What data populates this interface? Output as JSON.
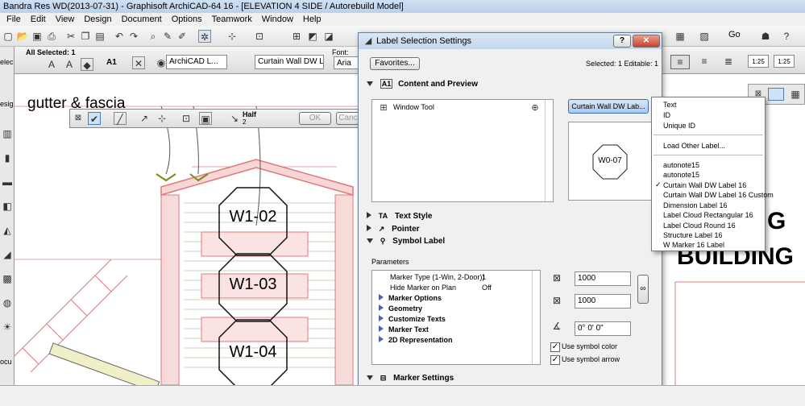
{
  "title": "Bandra Res WD(2013-07-31) - Graphisoft ArchiCAD-64 16 - [ELEVATION 4 SIDE / Autorebuild Model]",
  "menu": [
    "File",
    "Edit",
    "View",
    "Design",
    "Document",
    "Options",
    "Teamwork",
    "Window",
    "Help"
  ],
  "infobar": {
    "all_selected": "All Selected: 1",
    "layer": "ArchiCAD L...",
    "label_name": "Curtain Wall DW L...",
    "font_label": "Font:",
    "font_value": "Aria",
    "go_label": "Go",
    "scale_a": "1:25",
    "scale_b": "1:25",
    "tool_text": "A1"
  },
  "left_labels": [
    "elec",
    "esig",
    "ocu"
  ],
  "palette": {
    "half_label": "Half",
    "half_value": "2",
    "ok": "OK",
    "cancel": "Canc"
  },
  "drawing": {
    "gutter_text": "gutter & fascia",
    "markers": [
      "W1-02",
      "W1-03",
      "W1-04"
    ],
    "right_text_1": "G",
    "right_text_2": "BUILDING"
  },
  "dialog": {
    "title": "Label Selection Settings",
    "favorites": "Favorites...",
    "selected_info": "Selected: 1 Editable: 1",
    "content_preview": "Content and Preview",
    "tool_name": "Window Tool",
    "label_button": "Curtain Wall DW Lab...",
    "preview_marker": "W0-07",
    "text_style": "Text Style",
    "pointer": "Pointer",
    "symbol_label": "Symbol Label",
    "parameters": "Parameters",
    "params": [
      {
        "name": "Marker Type (1-Win, 2-Door))",
        "value": "1",
        "bold": false
      },
      {
        "name": "Hide Marker on Plan",
        "value": "Off",
        "bold": false
      },
      {
        "name": "Marker Options",
        "value": "",
        "bold": true
      },
      {
        "name": "Geometry",
        "value": "",
        "bold": true
      },
      {
        "name": "Customize Texts",
        "value": "",
        "bold": true
      },
      {
        "name": "Marker Text",
        "value": "",
        "bold": true
      },
      {
        "name": "2D Representation",
        "value": "",
        "bold": true
      }
    ],
    "width_value": "1000",
    "height_value": "1000",
    "angle_value": "0° 0' 0\"",
    "use_symbol_color": "Use symbol color",
    "use_symbol_arrow": "Use symbol arrow",
    "marker_settings": "Marker Settings"
  },
  "dropdown": {
    "group1": [
      "Text",
      "ID",
      "Unique ID"
    ],
    "load_other": "Load Other Label...",
    "group2": [
      "autonote15",
      "autonote15",
      "Curtain Wall DW Label 16",
      "Curtain Wall DW Label 16 Custom",
      "Dimension Label 16",
      "Label Cloud Rectangular 16",
      "Label Cloud Round 16",
      "Structure Label 16",
      "W Marker 16 Label"
    ],
    "checked": "Curtain Wall DW Label 16"
  }
}
